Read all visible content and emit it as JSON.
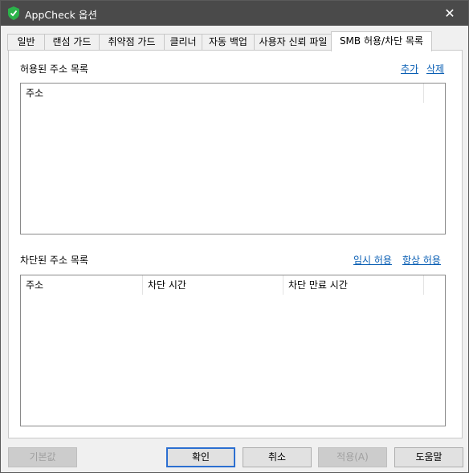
{
  "window": {
    "title": "AppCheck 옵션",
    "close_glyph": "✕"
  },
  "tabs": [
    {
      "label": "일반"
    },
    {
      "label": "랜섬 가드"
    },
    {
      "label": "취약점 가드"
    },
    {
      "label": "클리너"
    },
    {
      "label": "자동 백업"
    },
    {
      "label": "사용자 신뢰 파일"
    },
    {
      "label": "SMB 허용/차단 목록",
      "active": true
    }
  ],
  "allowed": {
    "title": "허용된 주소 목록",
    "add_label": "추가",
    "delete_label": "삭제",
    "columns": [
      "주소"
    ]
  },
  "blocked": {
    "title": "차단된 주소 목록",
    "temp_allow_label": "임시 허용",
    "always_allow_label": "항상 허용",
    "columns": [
      "주소",
      "차단 시간",
      "차단 만료 시간"
    ]
  },
  "buttons": {
    "default_label": "기본값",
    "ok_label": "확인",
    "cancel_label": "취소",
    "apply_label": "적용(A)",
    "help_label": "도움말"
  },
  "colors": {
    "titlebar": "#4a4a4a",
    "accent": "#2c6fd1",
    "icon": "#2bb34a"
  }
}
